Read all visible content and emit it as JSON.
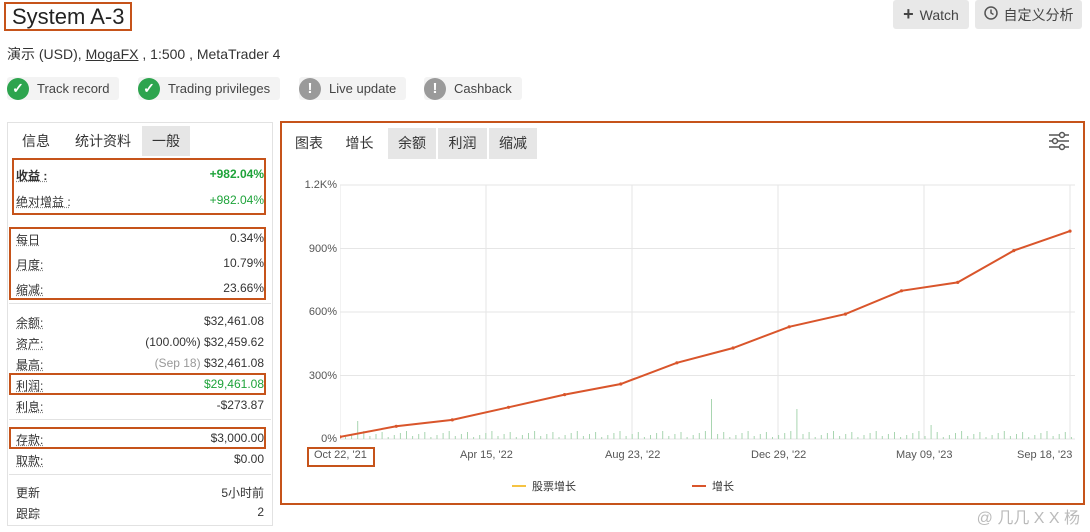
{
  "header": {
    "title": "System A-3",
    "account_prefix": "演示 (USD), ",
    "broker": "MogaFX",
    "account_suffix": " , 1:500 , MetaTrader 4",
    "watch_label": "Watch",
    "custom_analysis_label": "自定义分析"
  },
  "badges": [
    {
      "label": "Track record",
      "icon": "check-icon",
      "status": "ok"
    },
    {
      "label": "Trading privileges",
      "icon": "check-icon",
      "status": "ok"
    },
    {
      "label": "Live update",
      "icon": "exclamation-icon",
      "status": "warn"
    },
    {
      "label": "Cashback",
      "icon": "exclamation-icon",
      "status": "warn"
    }
  ],
  "left_tabs": [
    "信息",
    "统计资料",
    "一般"
  ],
  "stats": {
    "gain_label": "收益 :",
    "gain_value": "+982.04%",
    "abs_gain_label": "绝对增益 :",
    "abs_gain_value": "+982.04%",
    "daily_label": "每日",
    "daily_value": "0.34%",
    "monthly_label": "月度:",
    "monthly_value": "10.79%",
    "drawdown_label": "缩减:",
    "drawdown_value": "23.66%",
    "balance_label": "余额:",
    "balance_value": "$32,461.08",
    "equity_label": "资产:",
    "equity_pct": "(100.00%)",
    "equity_value": "$32,459.62",
    "highest_label": "最高:",
    "highest_date": "(Sep 18)",
    "highest_value": "$32,461.08",
    "profit_label": "利润:",
    "profit_value": "$29,461.08",
    "interest_label": "利息:",
    "interest_value": "-$273.87",
    "deposits_label": "存款:",
    "deposits_value": "$3,000.00",
    "withdrawals_label": "取款:",
    "withdrawals_value": "$0.00",
    "updated_label": "更新",
    "updated_value": "5小时前",
    "tracking_label": "跟踪",
    "tracking_value": "2"
  },
  "chart_tabs": [
    "图表",
    "增长",
    "余额",
    "利润",
    "缩减"
  ],
  "chart_data": {
    "type": "line",
    "y_ticks": [
      "0%",
      "300%",
      "600%",
      "900%",
      "1.2K%"
    ],
    "ylim": [
      0,
      1200
    ],
    "x_ticks": [
      "Oct 22, '21",
      "Apr 15, '22",
      "Aug 23, '22",
      "Dec 29, '22",
      "May 09, '23",
      "Sep 18, '23"
    ],
    "series": [
      {
        "name": "增长",
        "color": "#d9552b",
        "x": [
          "Oct 22, '21",
          "Nov '21",
          "Jan '22",
          "Apr 15, '22",
          "Jun '22",
          "Jul '22",
          "Aug 23, '22",
          "Oct '22",
          "Dec 29, '22",
          "Feb '23",
          "Mar '23",
          "May 09, '23",
          "Jul '23",
          "Sep 18, '23"
        ],
        "values": [
          10,
          60,
          90,
          150,
          210,
          260,
          360,
          430,
          530,
          590,
          700,
          740,
          890,
          982
        ]
      },
      {
        "name": "股票增长",
        "color": "#f5c342",
        "x": [],
        "values": []
      }
    ],
    "grid": true,
    "legend_position": "bottom"
  },
  "watermark": "@ 几几 X X 杨"
}
